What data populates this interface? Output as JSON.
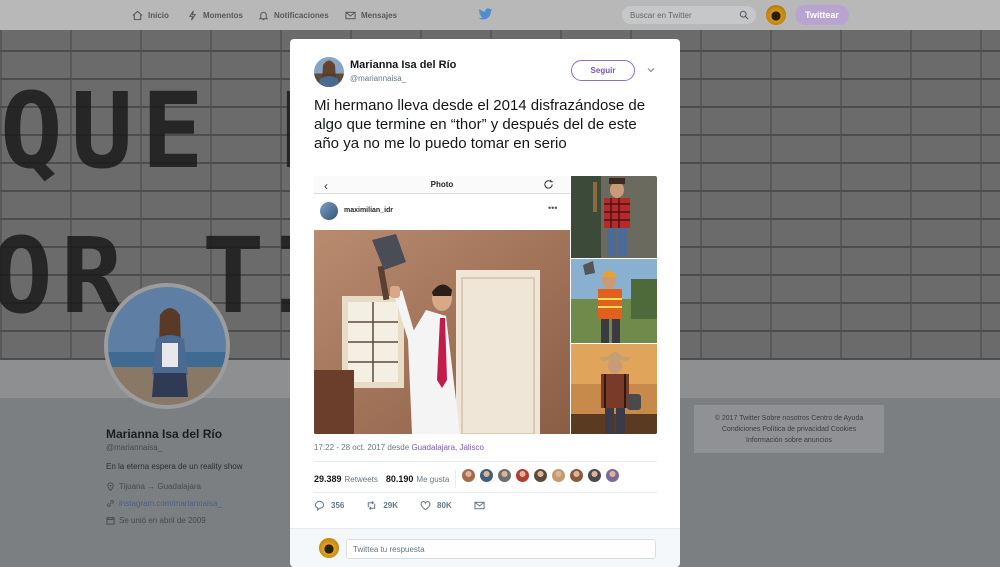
{
  "nav": {
    "items": [
      {
        "label": "Inicio",
        "icon": "home-icon"
      },
      {
        "label": "Momentos",
        "icon": "lightning-icon"
      },
      {
        "label": "Notificaciones",
        "icon": "bell-icon"
      },
      {
        "label": "Mensajes",
        "icon": "envelope-icon"
      }
    ],
    "search_placeholder": "Buscar en Twitter",
    "tweet_button": "Twittear"
  },
  "banner": {
    "top_text": "QUE MUCH",
    "bottom_text": "OR TIR"
  },
  "profile": {
    "name": "Marianna Isa del Río",
    "handle": "@mariannaisa_",
    "bio": "En la eterna espera de un reality show",
    "location": "Tijuana → Guadalajara",
    "website": "instagram.com/mariannaisa_",
    "joined": "Se unió en abril de 2009"
  },
  "footer": {
    "line1": "© 2017 Twitter   Sobre nosotros   Centro de Ayuda",
    "line2": "Condiciones   Política de privacidad   Cookies",
    "line3": "Información sobre anuncios"
  },
  "tweet": {
    "author_name": "Marianna Isa del Río",
    "author_handle": "@mariannaisa_",
    "follow_label": "Seguir",
    "text": "Mi hermano lleva desde el 2014 disfrazándose de algo que termine en “thor” y después del de este año ya no me lo puedo tomar en serio",
    "photo": {
      "app_title": "Photo",
      "ig_username": "maximilian_idr"
    },
    "time": "17:22 - 28 oct. 2017",
    "time_joiner": "desde",
    "location": "Guadalajara, Jalisco",
    "retweets_count": "29.389",
    "retweets_label": "Retweets",
    "likes_count": "80.190",
    "likes_label": "Me gusta",
    "liker_colors": [
      "#a46a4a",
      "#3d5f7a",
      "#6e6e6e",
      "#b43b2f",
      "#5a4a3a",
      "#c59a6a",
      "#8a5a3a",
      "#4a4a4a",
      "#7a6a9a"
    ],
    "actions": {
      "replies": "356",
      "retweets": "29K",
      "likes": "80K"
    },
    "reply_placeholder": "Twittea tu respuesta"
  }
}
